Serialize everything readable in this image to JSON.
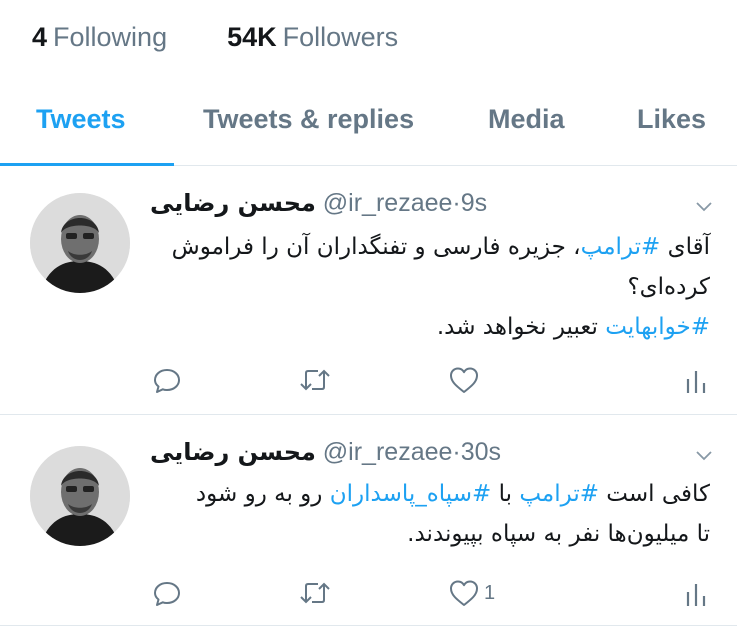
{
  "profile_stats": {
    "following_count": "4",
    "following_label": "Following",
    "followers_count": "54K",
    "followers_label": "Followers"
  },
  "tabs": [
    {
      "label": "Tweets",
      "active": true
    },
    {
      "label": "Tweets & replies",
      "active": false
    },
    {
      "label": "Media",
      "active": false
    },
    {
      "label": "Likes",
      "active": false
    }
  ],
  "accent_color": "#1da1f2",
  "muted_color": "#657786",
  "tweets": [
    {
      "display_name": "محسن رضایی",
      "handle": "@ir_rezaee",
      "separator": "·",
      "time": "9s",
      "line1_pre": "آقای ",
      "line1_hashtag": "#ترامپ",
      "line1_post": "، جزیره فارسی و تفنگداران آن را فراموش",
      "line2": "کرده‌ای؟",
      "line3_hashtag": "#خوابهایت",
      "line3_post": " تعبیر نخواهد شد.",
      "like_count": ""
    },
    {
      "display_name": "محسن رضایی",
      "handle": "@ir_rezaee",
      "separator": "·",
      "time": "30s",
      "line1_pre": "کافی است ",
      "line1_hashtag": "#ترامپ",
      "line1_mid": " با ",
      "line1_hashtag2": "#سپاه_پاسداران",
      "line1_post": " رو به رو شود",
      "line2": "تا میلیون‌ها نفر  به سپاه بپیوندند.",
      "like_count": "1"
    }
  ],
  "icons": [
    "reply-icon",
    "retweet-icon",
    "like-icon",
    "analytics-icon",
    "chevron-down-icon"
  ]
}
